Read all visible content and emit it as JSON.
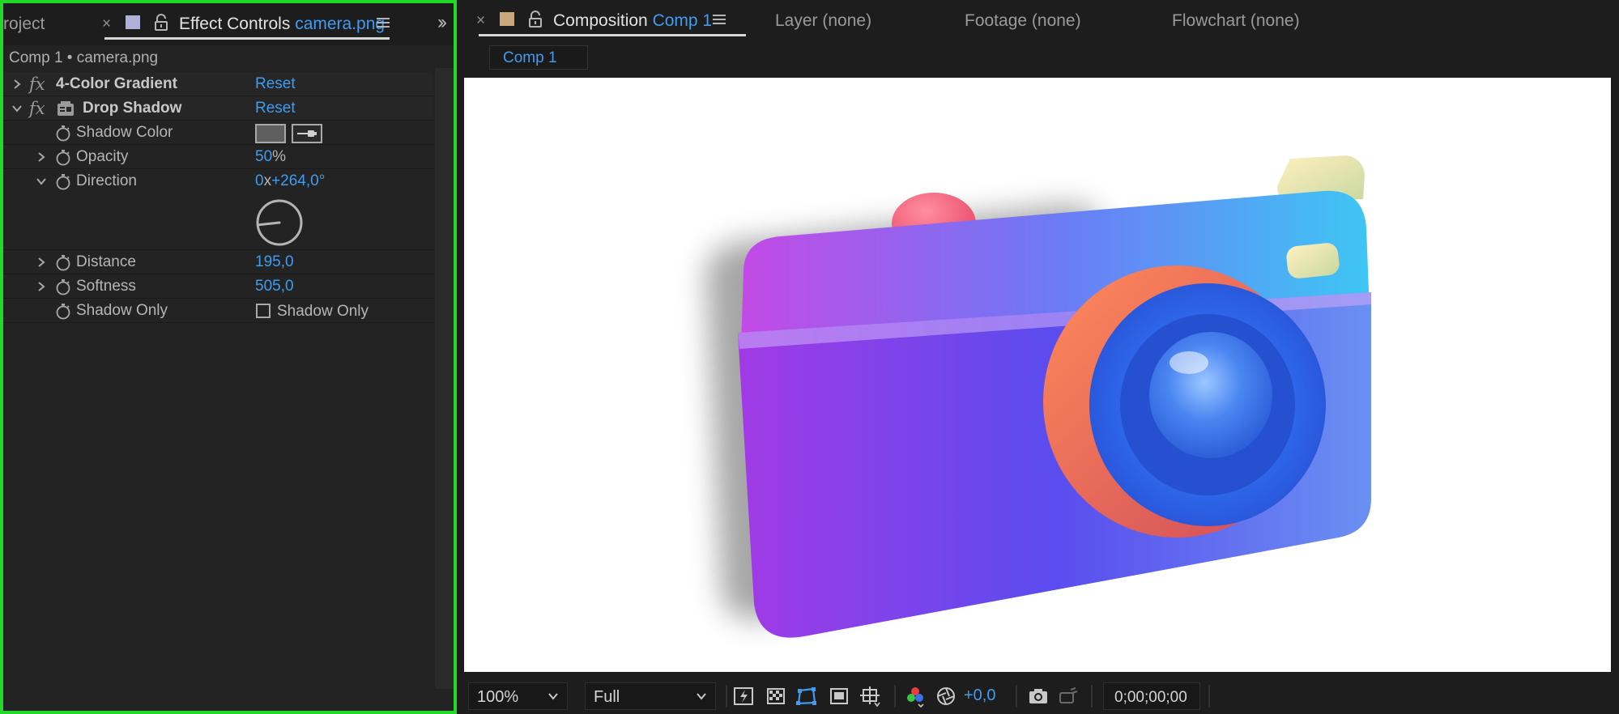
{
  "left_panel": {
    "tabs": {
      "project_label": "roject",
      "effect_controls_label": "Effect Controls",
      "effect_controls_target": "camera.png"
    },
    "breadcrumb": "Comp 1 • camera.png",
    "effects": [
      {
        "name": "4-Color Gradient",
        "reset_label": "Reset",
        "expanded": false
      },
      {
        "name": "Drop Shadow",
        "reset_label": "Reset",
        "expanded": true
      }
    ],
    "properties": {
      "shadow_color": {
        "label": "Shadow Color",
        "color": "#5f5f5f"
      },
      "opacity": {
        "label": "Opacity",
        "value": "50",
        "unit": "%"
      },
      "direction": {
        "label": "Direction",
        "revolutions": "0",
        "sep": "x",
        "angle": "+264,0°",
        "angle_deg": 264
      },
      "distance": {
        "label": "Distance",
        "value": "195,0"
      },
      "softness": {
        "label": "Softness",
        "value": "505,0"
      },
      "shadow_only": {
        "label": "Shadow Only",
        "checkbox_label": "Shadow Only",
        "checked": false
      }
    }
  },
  "right_panel": {
    "tabs": {
      "composition_label": "Composition",
      "composition_name": "Comp 1",
      "layer": "Layer (none)",
      "footage": "Footage (none)",
      "flowchart": "Flowchart (none)"
    },
    "subtab": "Comp 1",
    "toolbar": {
      "zoom": "100%",
      "resolution": "Full",
      "exposure": "+0,0",
      "timecode": "0;00;00;00"
    }
  },
  "colors": {
    "accent": "#3f9cf2",
    "highlight_border": "#22d92a",
    "panel_bg": "#232323"
  }
}
